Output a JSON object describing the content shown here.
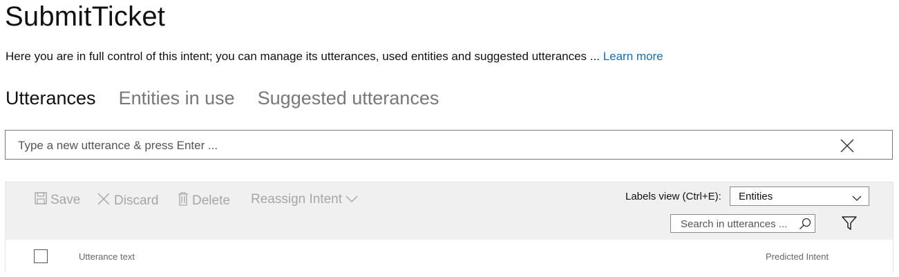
{
  "page": {
    "title": "SubmitTicket",
    "description": "Here you are in full control of this intent; you can manage its utterances, used entities and suggested utterances ...",
    "learn_more": "Learn more"
  },
  "tabs": [
    {
      "label": "Utterances",
      "active": true
    },
    {
      "label": "Entities in use",
      "active": false
    },
    {
      "label": "Suggested utterances",
      "active": false
    }
  ],
  "utterance_input": {
    "placeholder": "Type a new utterance & press Enter ...",
    "value": ""
  },
  "toolbar": {
    "save": "Save",
    "discard": "Discard",
    "delete": "Delete",
    "reassign": "Reassign Intent",
    "labels_view_label": "Labels view (Ctrl+E):",
    "labels_view_value": "Entities",
    "search_placeholder": "Search in utterances ..."
  },
  "table": {
    "columns": [
      "Utterance text",
      "Predicted Intent"
    ]
  },
  "colors": {
    "link": "#106ebe",
    "toolbar_bg": "#f0f0f0",
    "disabled_text": "#a6a6a6"
  }
}
